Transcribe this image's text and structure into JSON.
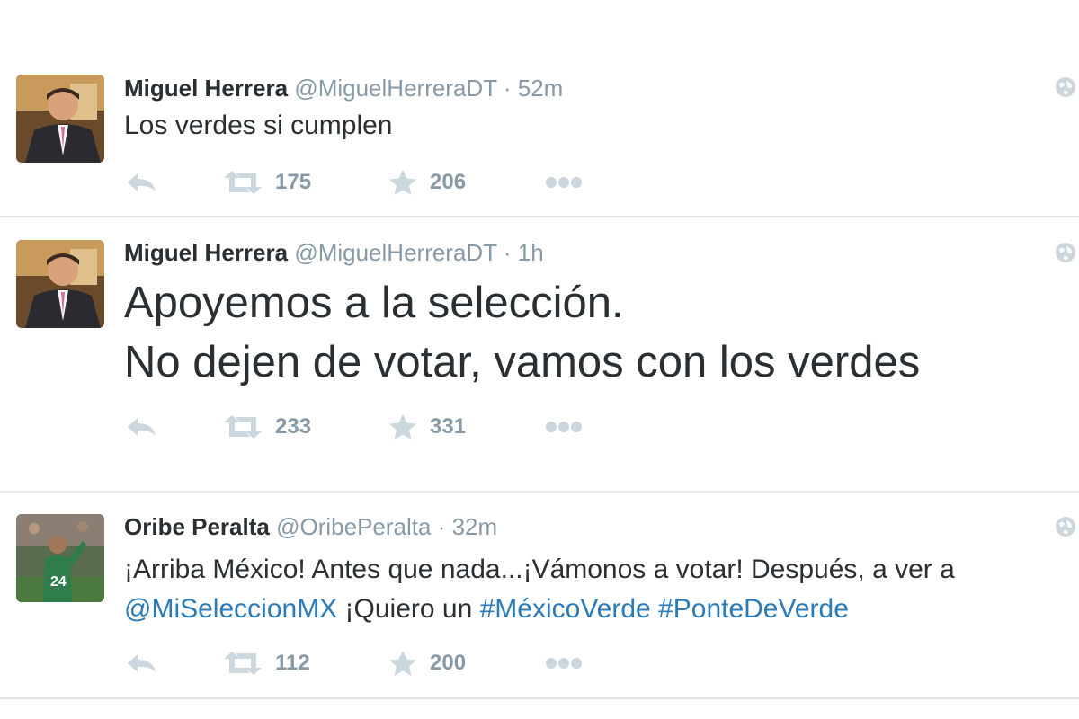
{
  "tweets": [
    {
      "fullname": "Miguel Herrera",
      "username": "@MiguelHerreraDT",
      "separator": "·",
      "time": "52m",
      "lines": [
        [
          "Los verdes si cumplen"
        ]
      ],
      "retweets": "175",
      "favorites": "206"
    },
    {
      "fullname": "Miguel Herrera",
      "username": "@MiguelHerreraDT",
      "separator": "·",
      "time": "1h",
      "lines": [
        [
          "Apoyemos a la selección."
        ],
        [
          "No dejen de votar, vamos con los verdes"
        ]
      ],
      "retweets": "233",
      "favorites": "331"
    },
    {
      "fullname": "Oribe Peralta",
      "username": "@OribePeralta",
      "separator": "·",
      "time": "32m",
      "lines": [
        [
          "¡Arriba México! Antes que nada...¡Vámonos a votar! Después, a ver a"
        ],
        [
          "@MiSeleccionMX",
          " ¡Quiero un ",
          "#MéxicoVerde",
          " ",
          "#PonteDeVerde"
        ]
      ],
      "retweets": "112",
      "favorites": "200"
    }
  ],
  "colors": {
    "text": "#292f33",
    "meta": "#8899a6",
    "link": "#2b7bb9",
    "divider": "#e1e8ed"
  },
  "icons": [
    "reply-icon",
    "retweet-icon",
    "favorite-icon",
    "more-icon",
    "globe-icon"
  ]
}
